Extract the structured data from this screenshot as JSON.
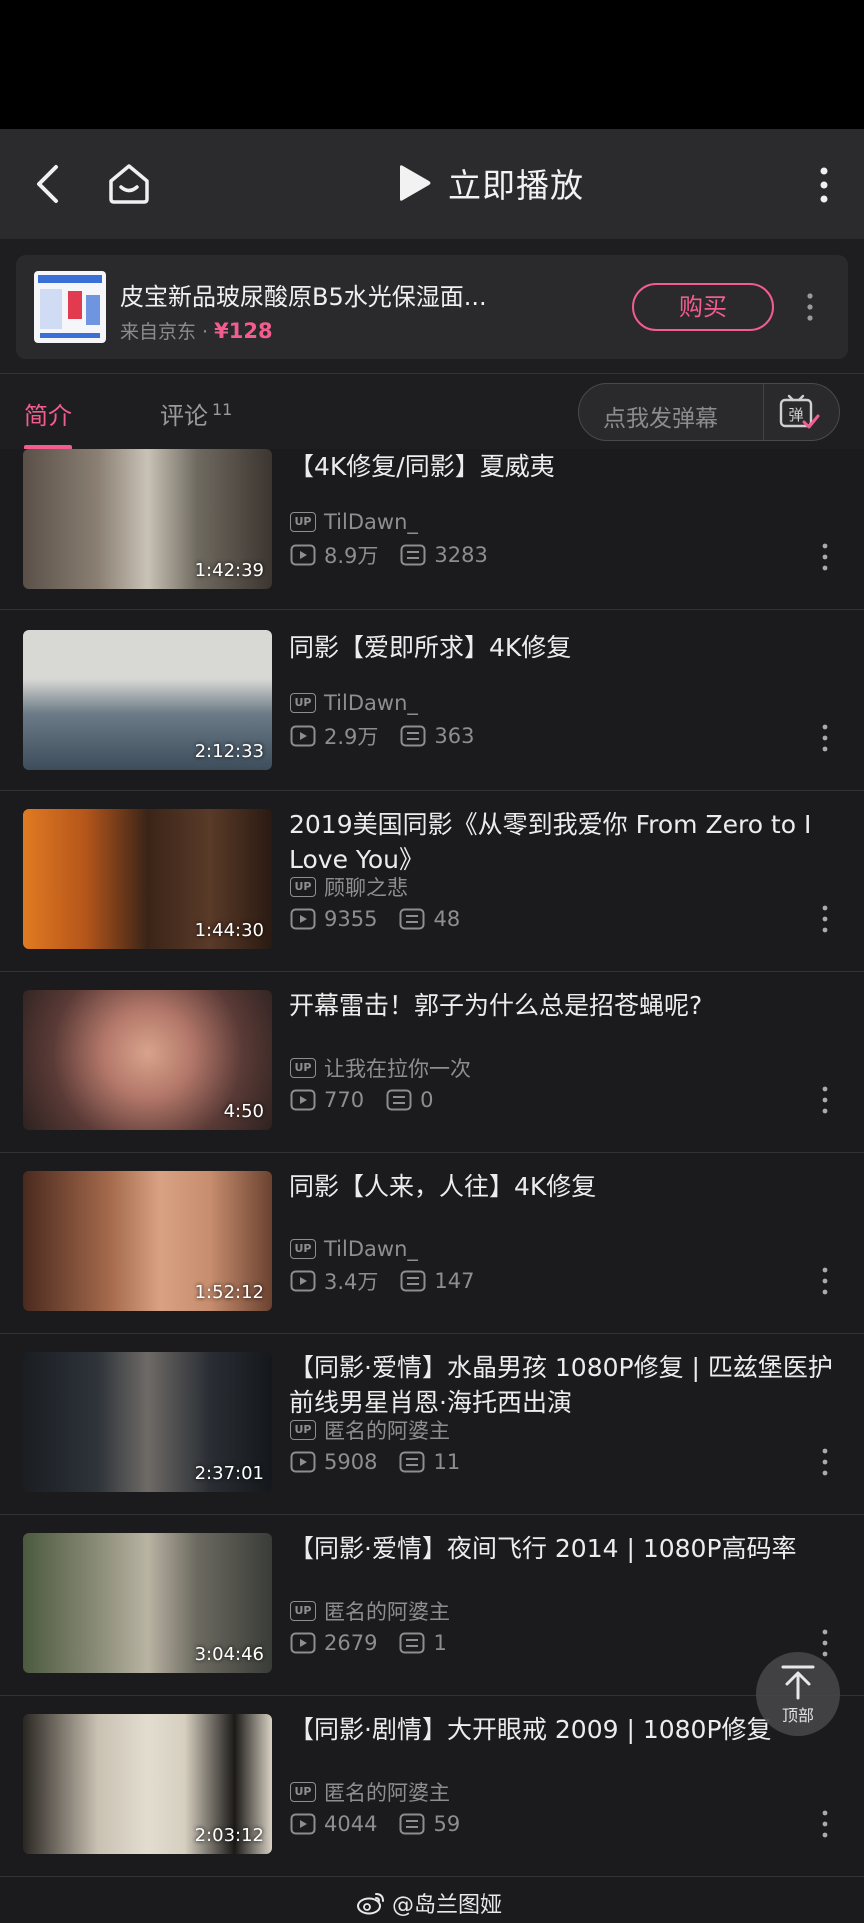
{
  "header": {
    "play_label": "立即播放"
  },
  "ad": {
    "title": "皮宝新品玻尿酸原B5水光保湿面...",
    "source": "来自京东 · ",
    "price": "¥128",
    "buy_label": "购买"
  },
  "tabs": {
    "intro": "简介",
    "comments": "评论",
    "comment_count": "11",
    "danmaku_placeholder": "点我发弹幕",
    "danmaku_icon_char": "弹"
  },
  "videos": [
    {
      "title": "【4K修复/同影】夏威夷",
      "uploader": "TilDawn_",
      "views": "8.9万",
      "danmaku": "3283",
      "duration": "1:42:39"
    },
    {
      "title": "同影【爱即所求】4K修复",
      "uploader": "TilDawn_",
      "views": "2.9万",
      "danmaku": "363",
      "duration": "2:12:33"
    },
    {
      "title": "2019美国同影《从零到我爱你 From Zero to I Love You》",
      "uploader": "顾聊之悲",
      "views": "9355",
      "danmaku": "48",
      "duration": "1:44:30"
    },
    {
      "title": "开幕雷击！郭子为什么总是招苍蝇呢?",
      "uploader": "让我在拉你一次",
      "views": "770",
      "danmaku": "0",
      "duration": "4:50"
    },
    {
      "title": "同影【人来，人往】4K修复",
      "uploader": "TilDawn_",
      "views": "3.4万",
      "danmaku": "147",
      "duration": "1:52:12"
    },
    {
      "title": "【同影·爱情】水晶男孩 1080P修复 | 匹兹堡医护前线男星肖恩·海托西出演",
      "uploader": "匿名的阿婆主",
      "views": "5908",
      "danmaku": "11",
      "duration": "2:37:01"
    },
    {
      "title": "【同影·爱情】夜间飞行 2014 | 1080P高码率",
      "uploader": "匿名的阿婆主",
      "views": "2679",
      "danmaku": "1",
      "duration": "3:04:46"
    },
    {
      "title": "【同影·剧情】大开眼戒 2009 | 1080P修复",
      "uploader": "匿名的阿婆主",
      "views": "4044",
      "danmaku": "59",
      "duration": "2:03:12"
    }
  ],
  "up_badge": "UP",
  "to_top_label": "顶部",
  "watermark": "@岛兰图娅",
  "colors": {
    "accent": "#f25d8e",
    "background": "#1b1b1d",
    "topbar": "#2b2b2d"
  }
}
